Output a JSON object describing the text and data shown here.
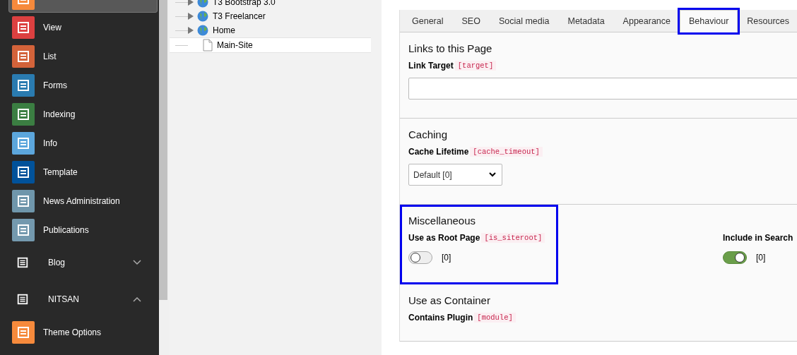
{
  "sidebar": {
    "items": [
      {
        "kind": "module",
        "color": "#f68a3c",
        "selected": true
      },
      {
        "kind": "module",
        "label": "View",
        "color": "#dc4040",
        "selected": false
      },
      {
        "kind": "module",
        "label": "List",
        "color": "#d3633a",
        "selected": false
      },
      {
        "kind": "module",
        "label": "Forms",
        "color": "#2a7bb0",
        "selected": false
      },
      {
        "kind": "module",
        "label": "Indexing",
        "color": "#3b7e42",
        "selected": false
      },
      {
        "kind": "module",
        "label": "Info",
        "color": "#5ca6dc",
        "selected": false
      },
      {
        "kind": "module",
        "label": "Template",
        "color": "#01529a",
        "selected": false
      },
      {
        "kind": "module",
        "label": "News Administration",
        "color": "#6f96ab",
        "selected": false
      },
      {
        "kind": "module",
        "label": "Publications",
        "color": "#7499ae",
        "selected": false
      },
      {
        "kind": "group",
        "label": "Blog",
        "expanded": false
      },
      {
        "kind": "group",
        "label": "NITSAN",
        "expanded": true
      },
      {
        "kind": "module",
        "label": "Theme Options",
        "color": "#f68a3c",
        "selected": false
      }
    ]
  },
  "page_tree": {
    "items": [
      {
        "kind": "site",
        "label": "T3 Bootstrap 3.0",
        "selected": false
      },
      {
        "kind": "site",
        "label": "T3 Freelancer",
        "selected": false
      },
      {
        "kind": "site",
        "label": "Home",
        "selected": false
      },
      {
        "kind": "page",
        "label": "Main-Site",
        "selected": true
      }
    ]
  },
  "tabs": [
    {
      "label": "General",
      "selected": false,
      "highlighted": false
    },
    {
      "label": "SEO",
      "selected": false,
      "highlighted": false
    },
    {
      "label": "Social media",
      "selected": false,
      "highlighted": false
    },
    {
      "label": "Metadata",
      "selected": false,
      "highlighted": false
    },
    {
      "label": "Appearance",
      "selected": false,
      "highlighted": false
    },
    {
      "label": "Behaviour",
      "selected": true,
      "highlighted": true
    },
    {
      "label": "Resources",
      "selected": false,
      "highlighted": false
    }
  ],
  "sections": [
    {
      "title": "Links to this Page",
      "highlighted": false,
      "fields": [
        {
          "kind": "text",
          "label": "Link Target",
          "code": "[target]"
        }
      ]
    },
    {
      "title": "Caching",
      "highlighted": false,
      "fields": [
        {
          "kind": "select",
          "label": "Cache Lifetime",
          "code": "[cache_timeout]",
          "value": "Default [0]"
        }
      ]
    },
    {
      "title": "Miscellaneous",
      "highlighted": true,
      "fields": [
        {
          "kind": "toggle",
          "label": "Use as Root Page",
          "code": "[is_siteroot]",
          "checked": false,
          "value": "[0]"
        },
        {
          "kind": "toggle",
          "label": "Include in Search",
          "checked": true,
          "value": "[0]"
        }
      ]
    },
    {
      "title": "Use as Container",
      "highlighted": false,
      "fields": [
        {
          "kind": "label",
          "label": "Contains Plugin",
          "code": "[module]"
        }
      ]
    }
  ]
}
